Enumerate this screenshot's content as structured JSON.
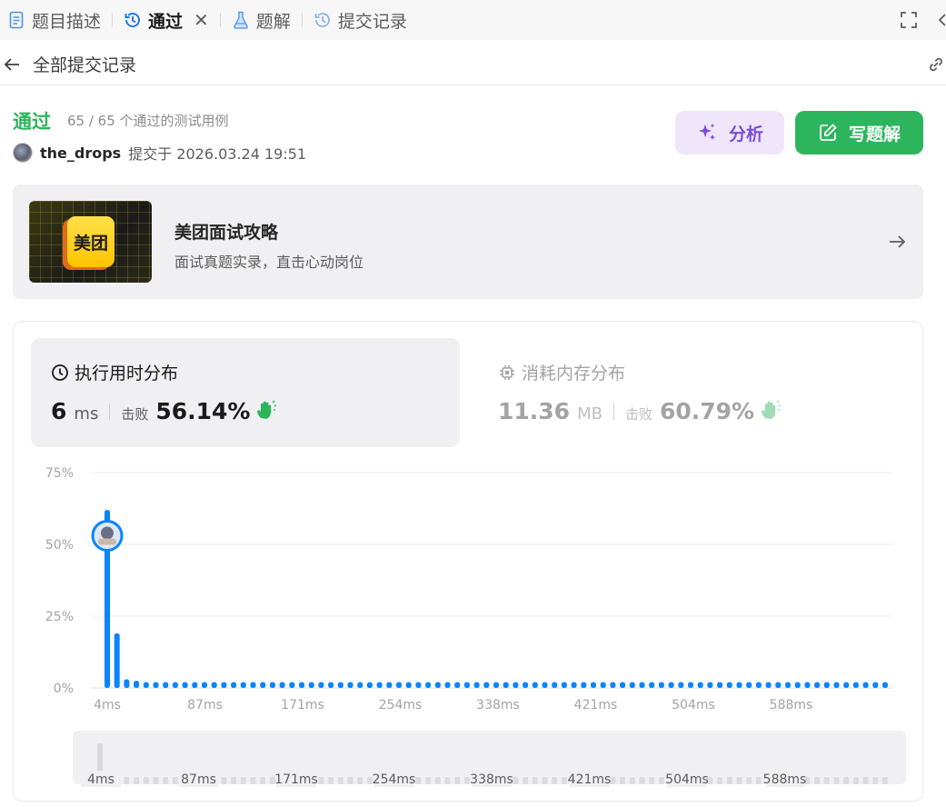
{
  "tabs": [
    {
      "label": "题目描述"
    },
    {
      "label": "通过"
    },
    {
      "label": "题解"
    },
    {
      "label": "提交记录"
    }
  ],
  "subheader": {
    "title": "全部提交记录"
  },
  "submission": {
    "status": "通过",
    "cases": "65 / 65 个通过的测试用例",
    "username": "the_drops",
    "submitted": "提交于 2026.03.24 19:51"
  },
  "buttons": {
    "analyze": "分析",
    "write_solution": "写题解"
  },
  "banner": {
    "logo_text": "美团",
    "title": "美团面试攻略",
    "subtitle": "面试真题实录，直击心动岗位"
  },
  "runtime": {
    "title": "执行用时分布",
    "value": "6",
    "unit": "ms",
    "beat_label": "击败",
    "beat_pct": "56.14%"
  },
  "memory": {
    "title": "消耗内存分布",
    "value": "11.36",
    "unit": "MB",
    "beat_label": "击败",
    "beat_pct": "60.79%"
  },
  "colors": {
    "accent_green": "#2db55d",
    "bar_blue": "#0a84ff",
    "analyze_purple": "#7a4bd8"
  },
  "chart_data": {
    "type": "bar",
    "title": "",
    "xlabel": "",
    "ylabel": "",
    "ylim": [
      0,
      75
    ],
    "yticks": [
      "75%",
      "50%",
      "25%",
      "0%"
    ],
    "xticks": [
      "4ms",
      "87ms",
      "171ms",
      "254ms",
      "338ms",
      "421ms",
      "504ms",
      "588ms"
    ],
    "values": [
      62,
      19,
      3,
      2.5,
      2,
      2,
      2,
      2,
      2,
      2,
      2,
      2,
      2,
      2,
      2,
      2,
      2,
      2,
      2,
      2,
      2,
      2,
      2,
      2,
      2,
      2,
      2,
      2,
      2,
      2,
      2,
      2,
      2,
      2,
      2,
      2,
      2,
      2,
      2,
      2,
      2,
      2,
      2,
      2,
      2,
      2,
      2,
      2,
      2,
      2,
      2,
      2,
      2,
      2,
      2,
      2,
      2,
      2,
      2,
      2,
      2,
      2,
      2,
      2,
      2,
      2,
      2,
      2,
      2,
      2,
      2,
      2,
      2,
      2,
      2,
      2,
      2,
      2,
      2,
      2,
      2
    ],
    "highlight_index": 0,
    "highlight_value": 53,
    "grid": true,
    "navigator_xticks": [
      "4ms",
      "87ms",
      "171ms",
      "254ms",
      "338ms",
      "421ms",
      "504ms",
      "588ms"
    ]
  }
}
